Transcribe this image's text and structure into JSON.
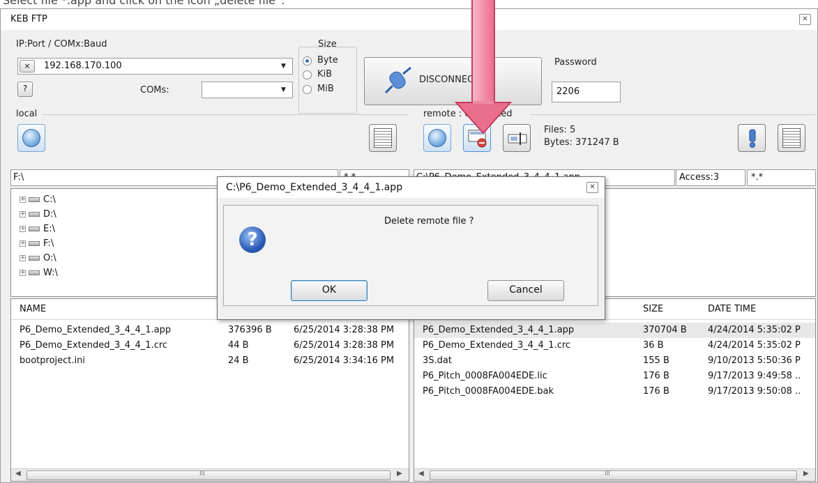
{
  "instruction": "Select file *.app and click on the icon „delete file“.",
  "window": {
    "title": "KEB FTP",
    "close_icon": "close-icon"
  },
  "connection": {
    "ip_label": "IP:Port / COMx:Baud",
    "ip_value": "192.168.170.100",
    "clear_glyph": "×",
    "help_glyph": "?",
    "coms_label": "COMs:",
    "coms_value": "",
    "size_label": "Size",
    "size_options": [
      "Byte",
      "KiB",
      "MiB"
    ],
    "size_selected": "Byte",
    "disconnect_label": "DISCONNECT",
    "password_label": "Password",
    "password_value": "2206"
  },
  "local": {
    "group_label": "local",
    "path": "F:\\",
    "filter": "*.*",
    "drives": [
      "C:\\",
      "D:\\",
      "E:\\",
      "F:\\",
      "O:\\",
      "W:\\"
    ],
    "columns": [
      "NAME",
      "",
      ""
    ],
    "files": [
      {
        "name": "P6_Demo_Extended_3_4_4_1.app",
        "size": "376396 B",
        "date": "6/25/2014 3:28:38 PM"
      },
      {
        "name": "P6_Demo_Extended_3_4_4_1.crc",
        "size": "44 B",
        "date": "6/25/2014 3:28:38 PM"
      },
      {
        "name": "bootproject.ini",
        "size": "24 B",
        "date": "6/25/2014 3:34:16 PM"
      }
    ]
  },
  "remote": {
    "group_label": "remote : connected",
    "files_count": "Files: 5",
    "bytes_total": "Bytes: 371247 B",
    "path": "C:\\P6_Demo_Extended_3_4_4_1.app",
    "access": "Access:3",
    "filter": "*.*",
    "columns": [
      "SIZE",
      "DATE TIME"
    ],
    "files": [
      {
        "name": "P6_Demo_Extended_3_4_4_1.app",
        "size": "370704 B",
        "date": "4/24/2014 5:35:02 P"
      },
      {
        "name": "P6_Demo_Extended_3_4_4_1.crc",
        "size": "36 B",
        "date": "4/24/2014 5:35:02 P"
      },
      {
        "name": "3S.dat",
        "size": "155 B",
        "date": "9/10/2013 5:50:36 P"
      },
      {
        "name": "P6_Pitch_0008FA004EDE.lic",
        "size": "176 B",
        "date": "9/17/2013 9:49:58 .."
      },
      {
        "name": "P6_Pitch_0008FA004EDE.bak",
        "size": "176 B",
        "date": "9/17/2013 9:50:08 .."
      }
    ]
  },
  "dialog": {
    "title": "C:\\P6_Demo_Extended_3_4_4_1.app",
    "message": "Delete remote file ?",
    "icon": "question-icon",
    "ok_label": "OK",
    "cancel_label": "Cancel"
  },
  "scroll_grip": "III",
  "colors": {
    "highlight_arrow": "#e96f8f",
    "accent": "#3b6fb8"
  }
}
